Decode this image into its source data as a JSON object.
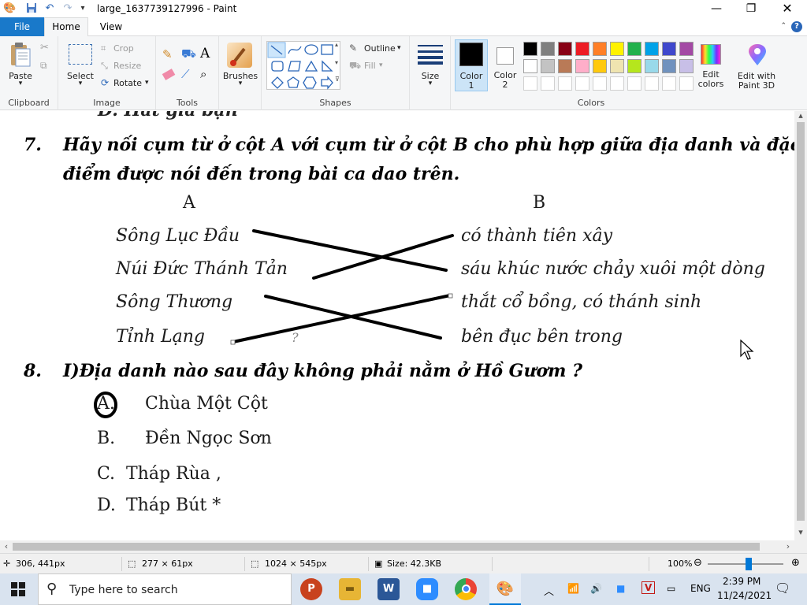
{
  "window": {
    "title": "large_1637739127996 - Paint"
  },
  "tabs": {
    "file": "File",
    "home": "Home",
    "view": "View"
  },
  "ribbon": {
    "clipboard": {
      "paste": "Paste",
      "group": "Clipboard"
    },
    "image": {
      "select": "Select",
      "crop": "Crop",
      "resize": "Resize",
      "rotate": "Rotate",
      "group": "Image"
    },
    "tools": {
      "group": "Tools",
      "text_tool": "A"
    },
    "brushes": "Brushes",
    "shapes": {
      "outline": "Outline",
      "fill": "Fill",
      "group": "Shapes"
    },
    "size": "Size",
    "color1": {
      "label1": "Color",
      "label2": "1"
    },
    "color2": {
      "label1": "Color",
      "label2": "2"
    },
    "colors_group": "Colors",
    "edit_colors": {
      "l1": "Edit",
      "l2": "colors"
    },
    "paint3d": {
      "l1": "Edit with",
      "l2": "Paint 3D"
    },
    "palette_row1": [
      "#000000",
      "#7f7f7f",
      "#880015",
      "#ed1c24",
      "#ff7f27",
      "#fff200",
      "#22b14c",
      "#00a2e8",
      "#3f48cc",
      "#a349a4"
    ],
    "palette_row2": [
      "#ffffff",
      "#c3c3c3",
      "#b97a57",
      "#ffaec9",
      "#ffc90e",
      "#efe4b0",
      "#b5e61d",
      "#99d9ea",
      "#7092be",
      "#c8bfe7"
    ]
  },
  "document": {
    "prev_option_partial": "D. Hát giã bạn",
    "q7_num": "7.",
    "q7_line1": "Hãy nối cụm từ ở cột A với cụm từ ở cột B cho phù hợp giữa địa danh và đặc",
    "q7_line2": "điểm được nói đến trong bài ca dao trên.",
    "col_a": "A",
    "col_b": "B",
    "col_a_items": [
      "Sông Lục Đầu",
      "Núi Đức Thánh Tản",
      "Sông Thương",
      "Tỉnh Lạng"
    ],
    "col_b_items": [
      "có thành tiên xây",
      "sáu khúc nước chảy xuôi một dòng",
      "thắt cổ bồng, có thánh sinh",
      "bên đục bên trong"
    ],
    "stray_mark": "?",
    "q8_num": "8.",
    "q8_text": "I)Địa danh nào sau đây không phải nằm ở Hồ Gươm ?",
    "q8_options": [
      {
        "letter": "A.",
        "text": "Chùa Một Cột"
      },
      {
        "letter": "B.",
        "text": "Đền Ngọc Sơn"
      },
      {
        "letter": "C.",
        "text": "Tháp Rùa ,"
      },
      {
        "letter": "D.",
        "text": "Tháp Bút *"
      }
    ]
  },
  "status": {
    "cursor_pos": "306, 441px",
    "selection_size": "277 × 61px",
    "image_size": "1024 × 545px",
    "file_size": "Size: 42.3KB",
    "zoom": "100%"
  },
  "taskbar": {
    "search_placeholder": "Type here to search",
    "lang": "ENG",
    "time": "2:39 PM",
    "date": "11/24/2021"
  }
}
